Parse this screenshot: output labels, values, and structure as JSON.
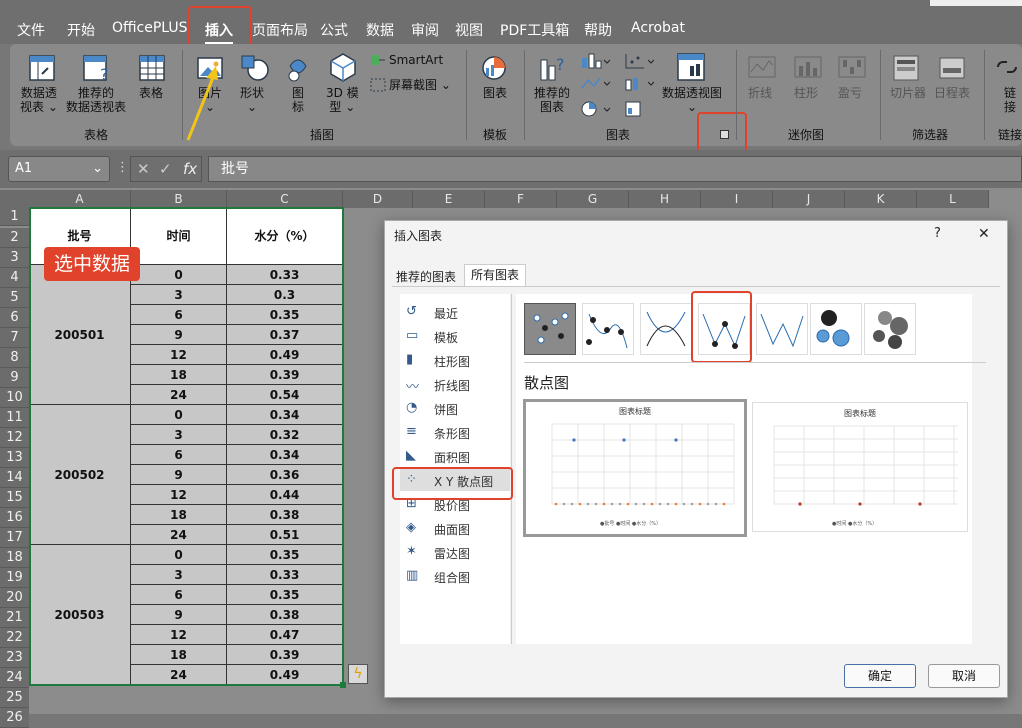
{
  "menubar": {
    "tabs": [
      "文件",
      "开始",
      "OfficePLUS",
      "插入",
      "页面布局",
      "公式",
      "数据",
      "审阅",
      "视图",
      "PDF工具箱",
      "帮助",
      "Acrobat"
    ],
    "active_tab": "插入"
  },
  "ribbon": {
    "pivot_label": "数据透\n视表 ⌄",
    "rec_pivot_label": "推荐的\n数据透视表",
    "table_label": "表格",
    "group_tables": "表格",
    "picture_label": "图片\n⌄",
    "shapes_label": "形状\n⌄",
    "icons_label": "图\n标",
    "model3d_label": "3D 模\n型 ⌄",
    "smartart_label": "SmartArt",
    "screenshot_label": "屏幕截图 ⌄",
    "group_illustrations": "插图",
    "chart_template_label": "图表",
    "group_template": "模板",
    "rec_charts_label": "推荐的\n图表",
    "pivot_chart_label": "数据透视图\n⌄",
    "group_charts": "图表",
    "spark_line": "折线",
    "spark_column": "柱形",
    "spark_winloss": "盈亏",
    "group_sparklines": "迷你图",
    "slicer": "切片器",
    "timeline": "日程表",
    "group_filters": "筛选器",
    "link": "链\n接",
    "group_links": "链接"
  },
  "formula_bar": {
    "name_box": "A1",
    "fx": "fx",
    "content": "批号"
  },
  "columns": [
    "A",
    "B",
    "C",
    "D",
    "E",
    "F",
    "G",
    "H",
    "I",
    "J",
    "K",
    "L"
  ],
  "rows": [
    "1",
    "2",
    "3",
    "4",
    "5",
    "6",
    "7",
    "8",
    "9",
    "10",
    "11",
    "12",
    "13",
    "14",
    "15",
    "16",
    "17",
    "18",
    "19",
    "20",
    "21",
    "22",
    "23",
    "24",
    "25",
    "26"
  ],
  "table": {
    "headers": [
      "批号",
      "时间",
      "水分（%）"
    ],
    "batches": [
      {
        "id": "200501",
        "times": [
          "0",
          "3",
          "6",
          "9",
          "12",
          "18",
          "24"
        ],
        "moisture": [
          "0.33",
          "0.3",
          "0.35",
          "0.37",
          "0.49",
          "0.39",
          "0.54"
        ]
      },
      {
        "id": "200502",
        "times": [
          "0",
          "3",
          "6",
          "9",
          "12",
          "18",
          "24"
        ],
        "moisture": [
          "0.34",
          "0.32",
          "0.34",
          "0.36",
          "0.44",
          "0.38",
          "0.51"
        ]
      },
      {
        "id": "200503",
        "times": [
          "0",
          "3",
          "6",
          "9",
          "12",
          "18",
          "24"
        ],
        "moisture": [
          "0.35",
          "0.33",
          "0.35",
          "0.38",
          "0.47",
          "0.39",
          "0.49"
        ]
      }
    ]
  },
  "annotation": "选中数据",
  "dialog": {
    "title": "插入图表",
    "help": "?",
    "close": "✕",
    "tabs": [
      "推荐的图表",
      "所有图表"
    ],
    "categories": [
      "最近",
      "模板",
      "柱形图",
      "折线图",
      "饼图",
      "条形图",
      "面积图",
      "X Y 散点图",
      "股价图",
      "曲面图",
      "雷达图",
      "组合图"
    ],
    "selected_category": "X Y 散点图",
    "section_title": "散点图",
    "preview_title": "图表标题",
    "preview1_legend": "●批号  ●时间  ●水分（%）",
    "preview2_legend": "●时间  ●水分（%）",
    "ok": "确定",
    "cancel": "取消"
  }
}
